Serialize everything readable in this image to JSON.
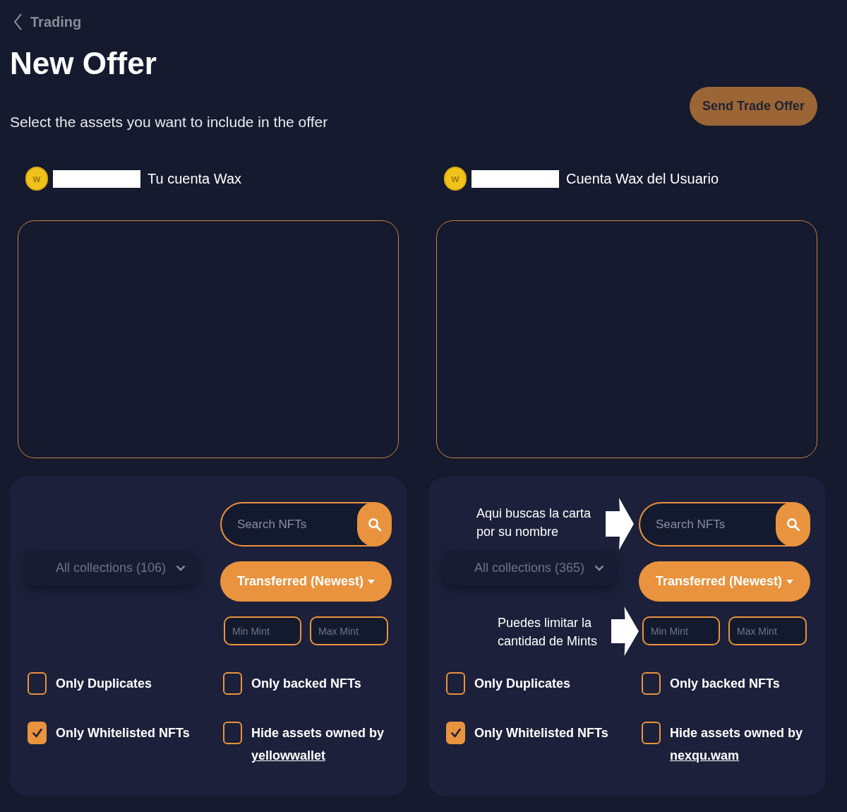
{
  "back_link": {
    "label": "Trading"
  },
  "title": "New Offer",
  "subtitle": "Select the assets you want to include in the offer",
  "send_button": {
    "label": "Send Trade Offer",
    "disabled": true
  },
  "sides": [
    {
      "account": {
        "coin_symbol": "w",
        "label": "Tu cuenta Wax"
      },
      "search": {
        "placeholder": "Search NFTs"
      },
      "collections": {
        "label": "All collections (106)"
      },
      "sort": {
        "label": "Transferred (Newest)"
      },
      "min_mint": {
        "placeholder": "Min Mint"
      },
      "max_mint": {
        "placeholder": "Max Mint"
      },
      "filters": [
        {
          "label": "Only Duplicates",
          "checked": false
        },
        {
          "label": "Only backed NFTs",
          "checked": false
        },
        {
          "label": "Only Whitelisted NFTs",
          "checked": true
        },
        {
          "label": "Hide assets owned by",
          "checked": false,
          "link": "yellowwallet"
        }
      ]
    },
    {
      "account": {
        "coin_symbol": "w",
        "label": "Cuenta Wax del Usuario"
      },
      "search_note": {
        "lines": [
          "Aqui buscas la carta",
          "por su nombre"
        ]
      },
      "search": {
        "placeholder": "Search NFTs"
      },
      "collections": {
        "label": "All collections (365)"
      },
      "sort": {
        "label": "Transferred (Newest)"
      },
      "mint_note": {
        "lines": [
          "Puedes limitar la",
          "cantidad de Mints"
        ]
      },
      "min_mint": {
        "placeholder": "Min Mint"
      },
      "max_mint": {
        "placeholder": "Max Mint"
      },
      "filters": [
        {
          "label": "Only Duplicates",
          "checked": false
        },
        {
          "label": "Only backed NFTs",
          "checked": false
        },
        {
          "label": "Only Whitelisted NFTs",
          "checked": true
        },
        {
          "label": "Hide assets owned by",
          "checked": false,
          "link": "nexqu.wam"
        }
      ]
    }
  ]
}
